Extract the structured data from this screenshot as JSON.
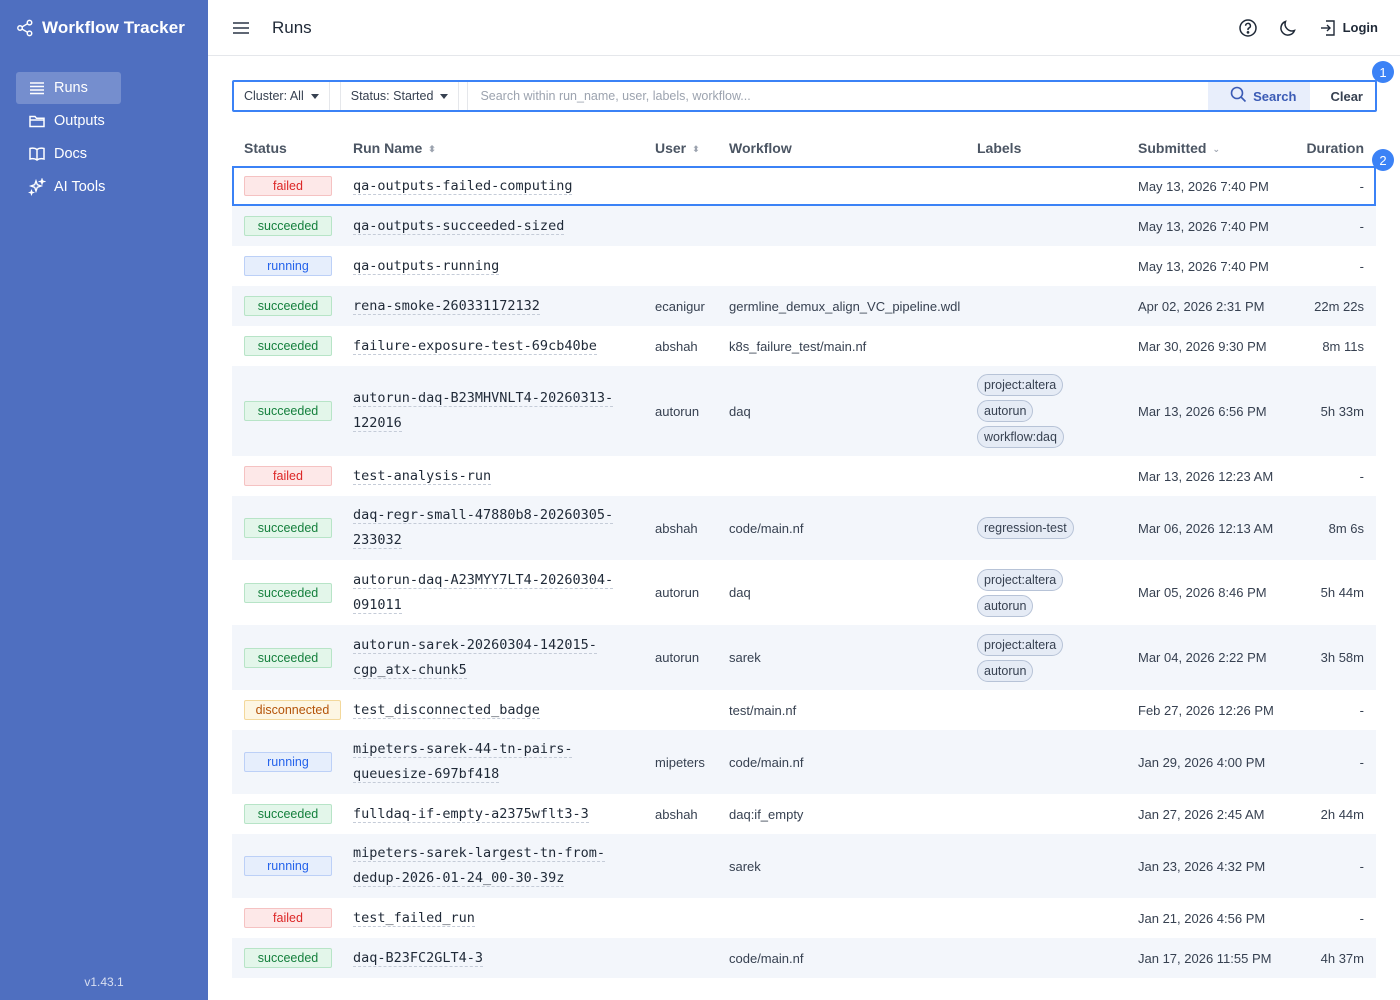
{
  "app": {
    "title": "Workflow Tracker",
    "version": "v1.43.1"
  },
  "sidebar": {
    "items": [
      {
        "label": "Runs",
        "icon": "list-icon",
        "active": true
      },
      {
        "label": "Outputs",
        "icon": "folder-icon",
        "active": false
      },
      {
        "label": "Docs",
        "icon": "book-icon",
        "active": false
      },
      {
        "label": "AI Tools",
        "icon": "sparkle-icon",
        "active": false
      }
    ]
  },
  "header": {
    "title": "Runs",
    "login_label": "Login"
  },
  "filters": {
    "cluster": "Cluster: All",
    "status": "Status: Started",
    "search_placeholder": "Search within run_name, user, labels, workflow...",
    "search_label": "Search",
    "clear_label": "Clear"
  },
  "markers": [
    "1",
    "2"
  ],
  "table": {
    "columns": [
      "Status",
      "Run Name",
      "User",
      "Workflow",
      "Labels",
      "Submitted",
      "Duration"
    ],
    "rows": [
      {
        "status": "failed",
        "name": [
          "qa-outputs-failed-computing"
        ],
        "user": "",
        "workflow": "",
        "labels": [],
        "submitted": "May 13, 2026 7:40 PM",
        "duration": "-"
      },
      {
        "status": "succeeded",
        "name": [
          "qa-outputs-succeeded-sized"
        ],
        "user": "",
        "workflow": "",
        "labels": [],
        "submitted": "May 13, 2026 7:40 PM",
        "duration": "-"
      },
      {
        "status": "running",
        "name": [
          "qa-outputs-running"
        ],
        "user": "",
        "workflow": "",
        "labels": [],
        "submitted": "May 13, 2026 7:40 PM",
        "duration": "-"
      },
      {
        "status": "succeeded",
        "name": [
          "rena-smoke-260331172132"
        ],
        "user": "ecanigur",
        "workflow": "germline_demux_align_VC_pipeline.wdl",
        "labels": [],
        "submitted": "Apr 02, 2026 2:31 PM",
        "duration": "22m 22s"
      },
      {
        "status": "succeeded",
        "name": [
          "failure-exposure-test-69cb40be"
        ],
        "user": "abshah",
        "workflow": "k8s_failure_test/main.nf",
        "labels": [],
        "submitted": "Mar 30, 2026 9:30 PM",
        "duration": "8m 11s"
      },
      {
        "status": "succeeded",
        "name": [
          "autorun-daq-B23MHVNLT4-20260313-",
          "122016"
        ],
        "user": "autorun",
        "workflow": "daq",
        "labels": [
          "project:altera",
          "autorun",
          "workflow:daq"
        ],
        "submitted": "Mar 13, 2026 6:56 PM",
        "duration": "5h 33m"
      },
      {
        "status": "failed",
        "name": [
          "test-analysis-run"
        ],
        "user": "",
        "workflow": "",
        "labels": [],
        "submitted": "Mar 13, 2026 12:23 AM",
        "duration": "-"
      },
      {
        "status": "succeeded",
        "name": [
          "daq-regr-small-47880b8-20260305-",
          "233032"
        ],
        "user": "abshah",
        "workflow": "code/main.nf",
        "labels": [
          "regression-test"
        ],
        "submitted": "Mar 06, 2026 12:13 AM",
        "duration": "8m 6s"
      },
      {
        "status": "succeeded",
        "name": [
          "autorun-daq-A23MYY7LT4-20260304-",
          "091011"
        ],
        "user": "autorun",
        "workflow": "daq",
        "labels": [
          "project:altera",
          "autorun"
        ],
        "submitted": "Mar 05, 2026 8:46 PM",
        "duration": "5h 44m"
      },
      {
        "status": "succeeded",
        "name": [
          "autorun-sarek-20260304-142015-",
          "cgp_atx-chunk5"
        ],
        "user": "autorun",
        "workflow": "sarek",
        "labels": [
          "project:altera",
          "autorun"
        ],
        "submitted": "Mar 04, 2026 2:22 PM",
        "duration": "3h 58m"
      },
      {
        "status": "disconnected",
        "name": [
          "test_disconnected_badge"
        ],
        "user": "",
        "workflow": "test/main.nf",
        "labels": [],
        "submitted": "Feb 27, 2026 12:26 PM",
        "duration": "-"
      },
      {
        "status": "running",
        "name": [
          "mipeters-sarek-44-tn-pairs-",
          "queuesize-697bf418"
        ],
        "user": "mipeters",
        "workflow": "code/main.nf",
        "labels": [],
        "submitted": "Jan 29, 2026 4:00 PM",
        "duration": "-"
      },
      {
        "status": "succeeded",
        "name": [
          "fulldaq-if-empty-a2375wflt3-3"
        ],
        "user": "abshah",
        "workflow": "daq:if_empty",
        "labels": [],
        "submitted": "Jan 27, 2026 2:45 AM",
        "duration": "2h 44m"
      },
      {
        "status": "running",
        "name": [
          "mipeters-sarek-largest-tn-from-",
          "dedup-2026-01-24_00-30-39z"
        ],
        "user": "",
        "workflow": "sarek",
        "labels": [],
        "submitted": "Jan 23, 2026 4:32 PM",
        "duration": "-"
      },
      {
        "status": "failed",
        "name": [
          "test_failed_run"
        ],
        "user": "",
        "workflow": "",
        "labels": [],
        "submitted": "Jan 21, 2026 4:56 PM",
        "duration": "-"
      },
      {
        "status": "succeeded",
        "name": [
          "daq-B23FC2GLT4-3"
        ],
        "user": "",
        "workflow": "code/main.nf",
        "labels": [],
        "submitted": "Jan 17, 2026 11:55 PM",
        "duration": "4h 37m"
      }
    ]
  }
}
